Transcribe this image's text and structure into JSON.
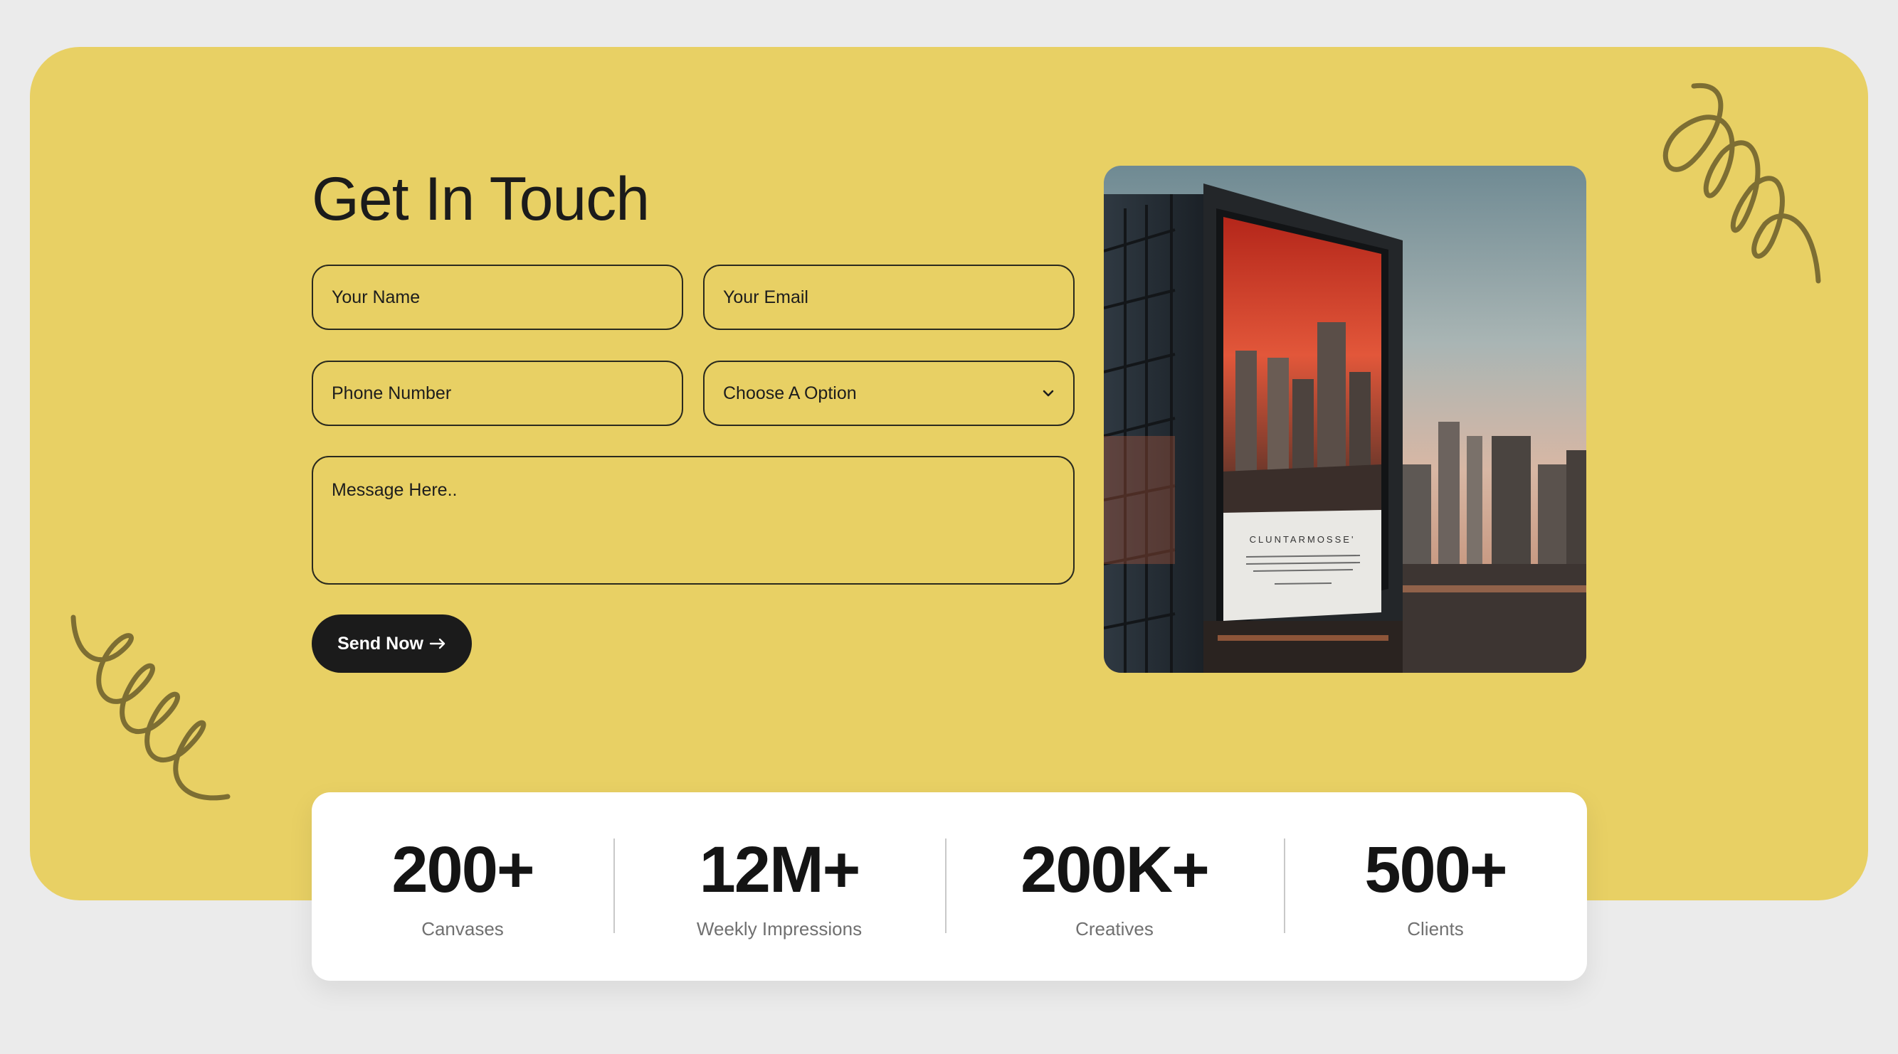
{
  "contact": {
    "title": "Get In Touch",
    "fields": {
      "name_placeholder": "Your Name",
      "email_placeholder": "Your Email",
      "phone_placeholder": "Phone Number",
      "option_selected": "Choose A Option",
      "message_placeholder": "Message Here.."
    },
    "send_label": "Send Now"
  },
  "billboard": {
    "brand_text": "CLUNTARMOSSE'"
  },
  "stats": [
    {
      "value": "200+",
      "label": "Canvases"
    },
    {
      "value": "12M+",
      "label": "Weekly Impressions"
    },
    {
      "value": "200K+",
      "label": "Creatives"
    },
    {
      "value": "500+",
      "label": "Clients"
    }
  ],
  "colors": {
    "hero_background": "#e8d064",
    "squiggle": "#7d6e33",
    "button": "#1b1b1b",
    "page_background": "#ebebeb"
  },
  "icons": {
    "select": "chevron-down-icon",
    "send": "arrow-right-icon"
  }
}
